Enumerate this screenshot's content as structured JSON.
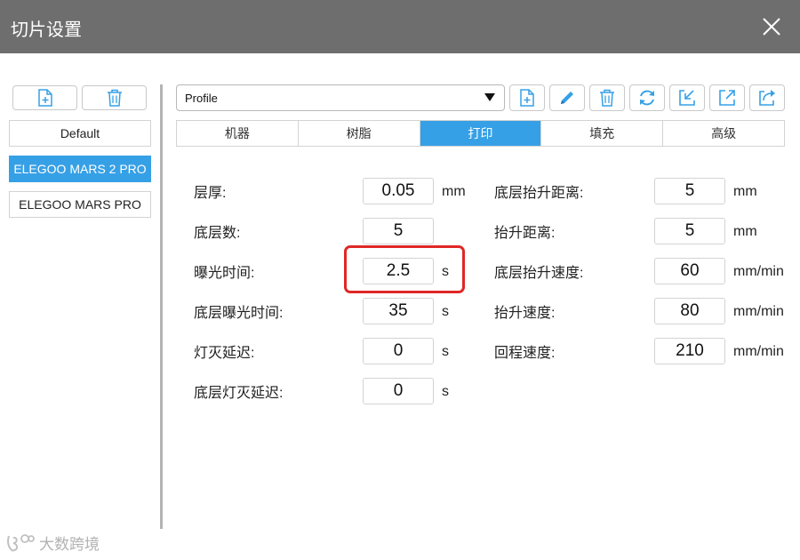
{
  "window": {
    "title": "切片设置"
  },
  "sidebar": {
    "buttons": [
      {
        "icon": "add-file-icon"
      },
      {
        "icon": "trash-icon"
      }
    ],
    "profiles": [
      {
        "label": "Default",
        "active": false
      },
      {
        "label": "ELEGOO MARS 2 PRO",
        "active": true
      },
      {
        "label": "ELEGOO MARS PRO",
        "active": false
      }
    ]
  },
  "toolbar": {
    "profile_select": {
      "value": "Profile"
    },
    "buttons": [
      {
        "icon": "add-file-icon"
      },
      {
        "icon": "pencil-icon"
      },
      {
        "icon": "trash-icon"
      },
      {
        "icon": "refresh-icon"
      },
      {
        "icon": "import-icon"
      },
      {
        "icon": "export-icon"
      },
      {
        "icon": "share-icon"
      }
    ]
  },
  "tabs": [
    {
      "label": "机器",
      "active": false
    },
    {
      "label": "树脂",
      "active": false
    },
    {
      "label": "打印",
      "active": true
    },
    {
      "label": "填充",
      "active": false
    },
    {
      "label": "高级",
      "active": false
    }
  ],
  "settings": {
    "left": [
      {
        "label": "层厚:",
        "value": "0.05",
        "unit": "mm"
      },
      {
        "label": "底层数:",
        "value": "5",
        "unit": ""
      },
      {
        "label": "曝光时间:",
        "value": "2.5",
        "unit": "s"
      },
      {
        "label": "底层曝光时间:",
        "value": "35",
        "unit": "s"
      },
      {
        "label": "灯灭延迟:",
        "value": "0",
        "unit": "s"
      },
      {
        "label": "底层灯灭延迟:",
        "value": "0",
        "unit": "s"
      }
    ],
    "right": [
      {
        "label": "底层抬升距离:",
        "value": "5",
        "unit": "mm"
      },
      {
        "label": "抬升距离:",
        "value": "5",
        "unit": "mm"
      },
      {
        "label": "底层抬升速度:",
        "value": "60",
        "unit": "mm/min"
      },
      {
        "label": "抬升速度:",
        "value": "80",
        "unit": "mm/min"
      },
      {
        "label": "回程速度:",
        "value": "210",
        "unit": "mm/min"
      }
    ]
  },
  "watermark": {
    "text": "大数跨境"
  },
  "colors": {
    "titlebar": "#6e6e6e",
    "accent": "#36a0e6",
    "highlight": "#e02727"
  }
}
